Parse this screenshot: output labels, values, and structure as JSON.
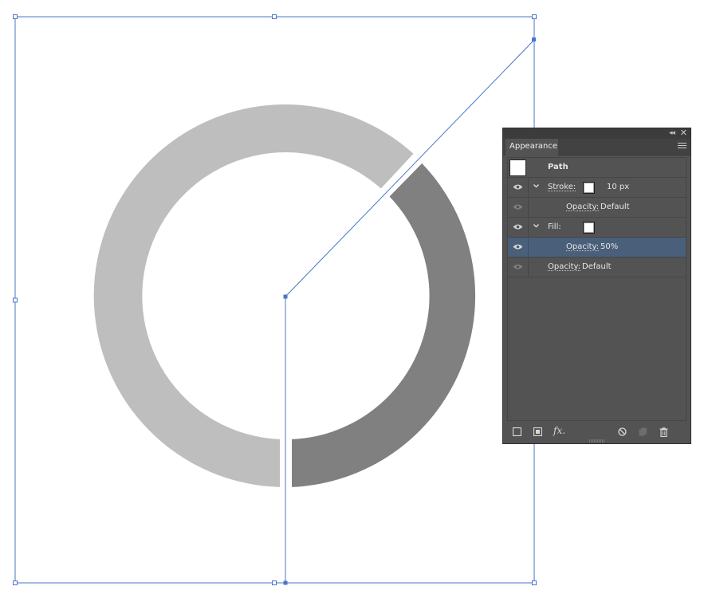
{
  "colors": {
    "ring_light": "#bebebe",
    "ring_dark": "#808080",
    "selection": "#4a76c8",
    "panel_bg": "#535353",
    "row_selected": "#4a5f79"
  },
  "panel": {
    "tab_label": "Appearance",
    "object_label": "Path",
    "rows": [
      {
        "label": "Stroke:",
        "value": "10 px"
      },
      {
        "label": "Opacity:",
        "value": "Default"
      },
      {
        "label": "Fill:",
        "value": ""
      },
      {
        "label": "Opacity:",
        "value": "50%"
      },
      {
        "label": "Opacity:",
        "value": "Default"
      }
    ],
    "fx_label": "fx."
  }
}
